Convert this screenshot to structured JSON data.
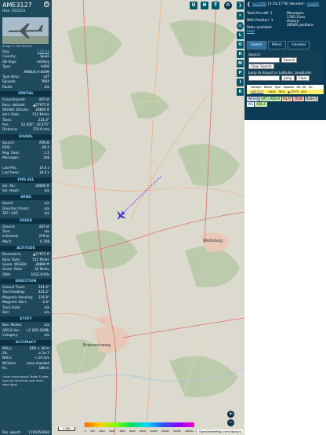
{
  "infoblock": {
    "callsign": "AME3127",
    "hex": "Hex: 3532CA",
    "photo_credit": "Image © Tim McGuire",
    "details": [
      {
        "k": "Reg.:",
        "v": "T.22-11",
        "link": true
      },
      {
        "k": "Country:",
        "v": "Spain"
      },
      {
        "k": "DB flags:",
        "v": "military"
      },
      {
        "k": "Type:",
        "v": "A400"
      },
      {
        "k": "",
        "v": "AIRBUS A-400M"
      },
      {
        "k": "Type Desc.:",
        "v": "L4T"
      },
      {
        "k": "Squawk:",
        "v": "7604"
      },
      {
        "k": "Route:",
        "v": "n/a"
      }
    ],
    "spatial_title": "SPATIAL",
    "spatial": [
      {
        "k": "Groundspeed:",
        "v": "445 kt"
      },
      {
        "k": "Baro. altitude:",
        "v": "▲27975 ft"
      },
      {
        "k": "WGS84 altitude:",
        "v": "28800 ft"
      },
      {
        "k": "Vert. Rate:",
        "v": "512 ft/min"
      },
      {
        "k": "Track:",
        "v": "221.4°"
      },
      {
        "k": "Pos.:",
        "v": "52.426°, 10.575°"
      },
      {
        "k": "Distance:",
        "v": "174.6 nmi"
      }
    ],
    "signal_title": "SIGNAL",
    "signal": [
      {
        "k": "Source:",
        "v": "ADS-B"
      },
      {
        "k": "RSSI:",
        "v": "-28.2"
      },
      {
        "k": "Msg. Rate:",
        "v": "1.5"
      },
      {
        "k": "Messages:",
        "v": "148"
      },
      {
        "k": "",
        "v": ""
      },
      {
        "k": "Last Pos.:",
        "v": "14.4 s"
      },
      {
        "k": "Last Seen:",
        "v": "14.4 s"
      }
    ],
    "fms_title": "FMS SEL",
    "fms": [
      {
        "k": "Sel. Alt.:",
        "v": "28000 ft"
      },
      {
        "k": "Sel. Head.:",
        "v": "n/a"
      }
    ],
    "wind_title": "WIND",
    "wind": [
      {
        "k": "Speed:",
        "v": "n/a"
      },
      {
        "k": "Direction (from):",
        "v": "n/a"
      },
      {
        "k": "TAT / OAT:",
        "v": "n/a"
      }
    ],
    "speed_title": "SPEED",
    "speed": [
      {
        "k": "Ground:",
        "v": "445 kt"
      },
      {
        "k": "True:",
        "v": "n/a"
      },
      {
        "k": "Indicated:",
        "v": "278 kt"
      },
      {
        "k": "Mach:",
        "v": "0.708"
      }
    ],
    "altitude_title": "ALTITUDE",
    "altitude": [
      {
        "k": "Barometric:",
        "v": "▲27975 ft"
      },
      {
        "k": "Baro. Rate:",
        "v": "512 ft/min"
      },
      {
        "k": "Geom. WGS84:",
        "v": "28800 ft"
      },
      {
        "k": "Geom. Rate:",
        "v": "32 ft/min"
      },
      {
        "k": "QNH:",
        "v": "1012.8 hPa"
      }
    ],
    "direction_title": "DIRECTION",
    "direction": [
      {
        "k": "Ground Track:",
        "v": "221.4°"
      },
      {
        "k": "True Heading:",
        "v": "221.2°"
      },
      {
        "k": "Magnetic Heading:",
        "v": "216.9°"
      },
      {
        "k": "Magnetic Decl.:",
        "v": "4.4°"
      },
      {
        "k": "Track Rate:",
        "v": "n/a"
      },
      {
        "k": "Roll:",
        "v": "n/a"
      }
    ],
    "stuff_title": "STUFF",
    "stuff": [
      {
        "k": "Nav. Modes:",
        "v": "n/a"
      },
      {
        "k": "ADS-B Ver.:",
        "v": "v2 (DO-260B)"
      },
      {
        "k": "Category:",
        "v": "n/a"
      }
    ],
    "accuracy_title": "ACCURACY",
    "accuracy": [
      {
        "k": "NACp:",
        "v": "EPU < 30 m"
      },
      {
        "k": "SIL:",
        "v": "≤ 1e-7"
      },
      {
        "k": "NACv:",
        "v": "< 10 m/s"
      },
      {
        "k": "NICbaro:",
        "v": "cross-checked"
      },
      {
        "k": "Rc:",
        "v": "186 m"
      }
    ],
    "learn_more": "Learn more about Mode S data type by hovering over each data label.",
    "epoch_label": "Pos. epoch:",
    "epoch_value": "1760353930"
  },
  "map": {
    "top_buttons": [
      "U",
      "H",
      "T"
    ],
    "side_buttons": [
      "L",
      "O",
      "K",
      "M",
      "P",
      "I",
      "R"
    ],
    "zoom_in": "+",
    "zoom_out": "−",
    "scale": "2 NM",
    "alt_ticks": [
      "0",
      "500",
      "1000",
      "2000",
      "4000",
      "6000",
      "8000",
      "10000",
      "20000",
      "30000",
      "40000+"
    ],
    "city_label": "Wolfsburg",
    "city2_label": "Braunschweig",
    "attribution": "© OpenStreetMap contributors."
  },
  "panel": {
    "title_link": "tar1090",
    "title_version": "(3.14.1776) decoder:",
    "title_link2": "readsb",
    "stats": {
      "total_aircraft_label": "Total Aircraft:",
      "total_aircraft": "1",
      "with_position_label": "With Position:",
      "with_position": "1",
      "messages_label": "Messages:",
      "messages": "1785.1/sec",
      "history_label": "History:",
      "history": "26589 positions",
      "stats_label": "Stats available",
      "stats_link": "here"
    },
    "tabs": [
      "Search",
      "Filters",
      "Columns"
    ],
    "search_label": "Search:",
    "search_button": "Search",
    "clear_search": "Clear Search",
    "jump_label": "Jump to Airport or Latitude, Longitude:",
    "jump_button": "Jump",
    "clear_button": "Clear",
    "table_headers": [
      "",
      "Callsign",
      "Route",
      "Type",
      "Squawk",
      "Alt. (ft)",
      "Sp"
    ],
    "table_row": [
      "",
      "AME3127",
      "",
      "A400",
      "7604",
      "▲27975",
      "445"
    ],
    "legend": [
      {
        "label": "ADS-B",
        "color": "#d7e4fb"
      },
      {
        "label": "UAT / ADS-R",
        "color": "#bff0b2"
      },
      {
        "label": "MLAT",
        "color": "#ffcfa6"
      },
      {
        "label": "TIS-B",
        "color": "#ffb3b3"
      },
      {
        "label": "Mode-S",
        "color": "#d6d6d6"
      },
      {
        "label": "AIS",
        "color": "#ffffff"
      },
      {
        "label": "ADS-C",
        "color": "#cbf1a8"
      }
    ]
  }
}
